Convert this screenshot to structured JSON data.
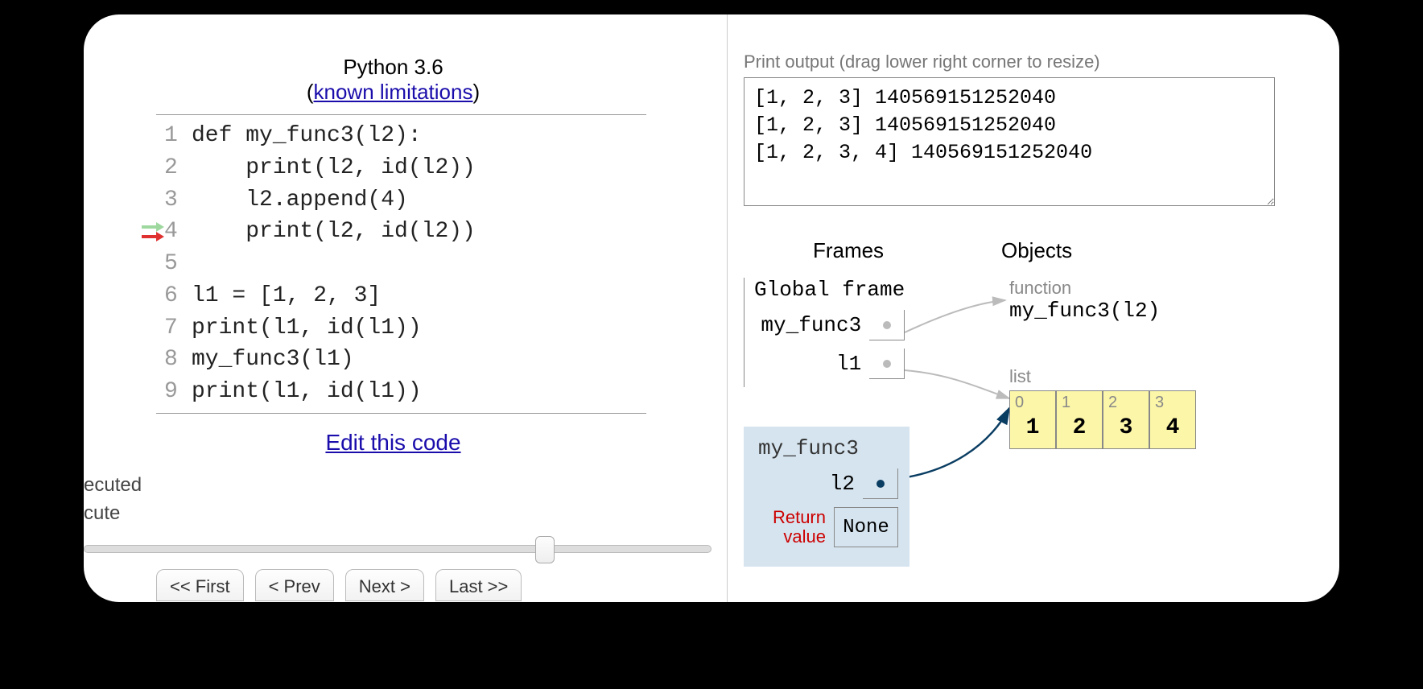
{
  "header": {
    "python_version": "Python 3.6",
    "limitations_prefix": "(",
    "limitations_link": "known limitations",
    "limitations_suffix": ")"
  },
  "code": {
    "lines": [
      {
        "n": "1",
        "text": "def my_func3(l2):",
        "greenArrow": false,
        "redArrow": false
      },
      {
        "n": "2",
        "text": "    print(l2, id(l2))",
        "greenArrow": false,
        "redArrow": false
      },
      {
        "n": "3",
        "text": "    l2.append(4)",
        "greenArrow": false,
        "redArrow": false
      },
      {
        "n": "4",
        "text": "    print(l2, id(l2))",
        "greenArrow": true,
        "redArrow": true
      },
      {
        "n": "5",
        "text": "",
        "greenArrow": false,
        "redArrow": false
      },
      {
        "n": "6",
        "text": "l1 = [1, 2, 3]",
        "greenArrow": false,
        "redArrow": false
      },
      {
        "n": "7",
        "text": "print(l1, id(l1))",
        "greenArrow": false,
        "redArrow": false
      },
      {
        "n": "8",
        "text": "my_func3(l1)",
        "greenArrow": false,
        "redArrow": false
      },
      {
        "n": "9",
        "text": "print(l1, id(l1))",
        "greenArrow": false,
        "redArrow": false
      }
    ]
  },
  "links": {
    "edit": "Edit this code"
  },
  "exec_status": {
    "line1": "ecuted",
    "line2": "cute"
  },
  "nav": {
    "first": "<< First",
    "prev": "< Prev",
    "next": "Next >",
    "last": "Last >>"
  },
  "output": {
    "label": "Print output (drag lower right corner to resize)",
    "text": "[1, 2, 3] 140569151252040\n[1, 2, 3] 140569151252040\n[1, 2, 3, 4] 140569151252040"
  },
  "viz": {
    "frames_header": "Frames",
    "objects_header": "Objects",
    "global_frame_title": "Global frame",
    "global_vars": [
      {
        "name": "my_func3"
      },
      {
        "name": "l1"
      }
    ],
    "func_frame_title": "my_func3",
    "func_vars": [
      {
        "name": "l2"
      }
    ],
    "return_label": "Return\nvalue",
    "return_value": "None",
    "obj_function_label": "function",
    "obj_function_text": "my_func3(l2)",
    "obj_list_label": "list",
    "list_items": [
      {
        "idx": "0",
        "val": "1"
      },
      {
        "idx": "1",
        "val": "2"
      },
      {
        "idx": "2",
        "val": "3"
      },
      {
        "idx": "3",
        "val": "4"
      }
    ]
  }
}
